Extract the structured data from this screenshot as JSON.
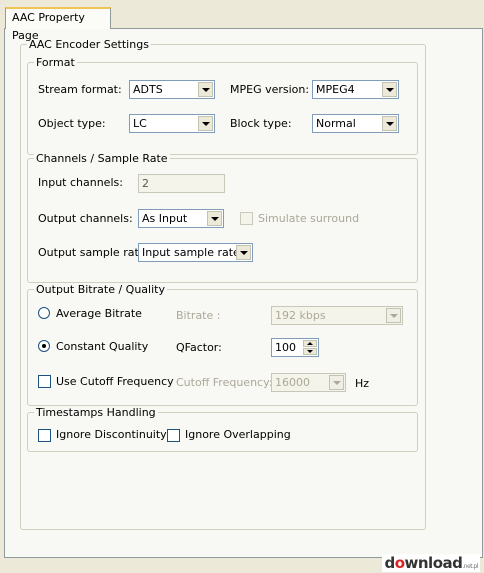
{
  "tab": {
    "label": "AAC Property Page"
  },
  "encoder": {
    "title": "AAC Encoder Settings",
    "format": {
      "title": "Format",
      "stream_format_label": "Stream format:",
      "stream_format_value": "ADTS",
      "mpeg_version_label": "MPEG version:",
      "mpeg_version_value": "MPEG4",
      "object_type_label": "Object type:",
      "object_type_value": "LC",
      "block_type_label": "Block type:",
      "block_type_value": "Normal"
    },
    "channels": {
      "title": "Channels / Sample Rate",
      "input_channels_label": "Input channels:",
      "input_channels_value": "2",
      "output_channels_label": "Output channels:",
      "output_channels_value": "As Input",
      "simulate_surround_label": "Simulate surround",
      "output_sample_rate_label": "Output sample rate:",
      "output_sample_rate_value": "Input sample rate"
    },
    "bitrate": {
      "title": "Output Bitrate / Quality",
      "average_bitrate_label": "Average Bitrate",
      "bitrate_label": "Bitrate :",
      "bitrate_value": "192 kbps",
      "constant_quality_label": "Constant Quality",
      "qfactor_label": "QFactor:",
      "qfactor_value": "100",
      "use_cutoff_label": "Use Cutoff Frequency",
      "cutoff_label": "Cutoff Frequency:",
      "cutoff_value": "16000",
      "hz_label": "Hz"
    },
    "timestamps": {
      "title": "Timestamps Handling",
      "ignore_discontinuity_label": "Ignore Discontinuity",
      "ignore_overlapping_label": "Ignore Overlapping"
    }
  },
  "watermark": {
    "text_pre": "d",
    "text_o": "o",
    "text_post": "wnload",
    "tld": ".net.pl"
  }
}
